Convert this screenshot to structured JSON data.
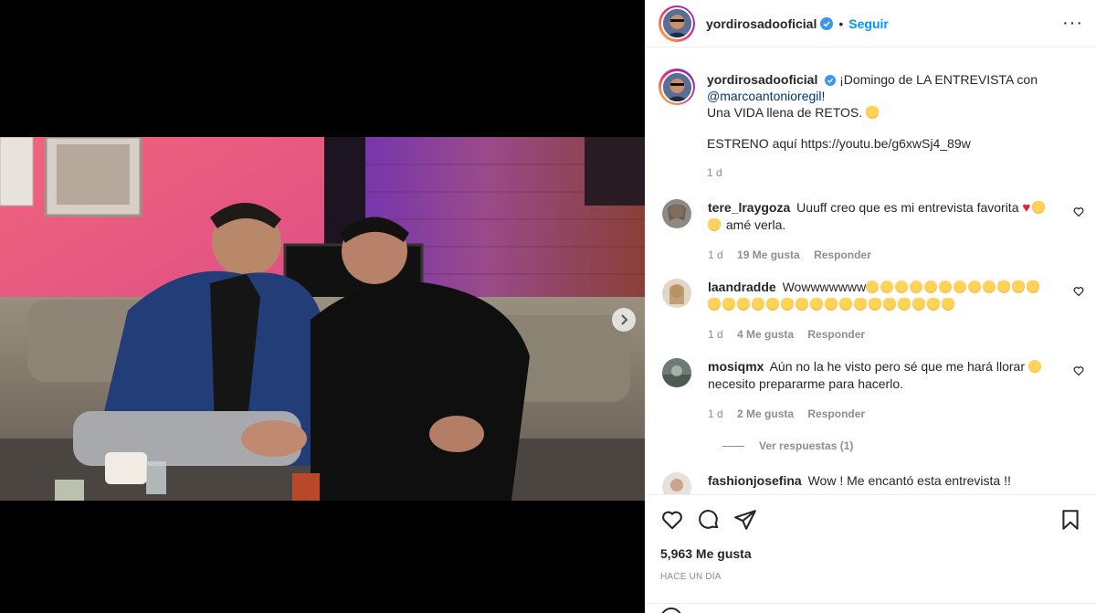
{
  "post": {
    "username": "yordirosadooficial",
    "follow_label": "Seguir",
    "more_label": "···",
    "caption_line1": "¡Domingo de LA ENTREVISTA con",
    "caption_mention": "@marcoantonioregil!",
    "caption_line2": "Una VIDA llena de RETOS.",
    "caption_line3": "ESTRENO aquí https://youtu.be/g6xwSj4_89w",
    "time": "1 d"
  },
  "comments": [
    {
      "username": "tere_lraygoza",
      "text": "Uuuff creo que es mi entrevista favorita",
      "text2": "amé verla.",
      "time": "1 d",
      "likes": "19 Me gusta",
      "reply_label": "Responder"
    },
    {
      "username": "laandradde",
      "text": "Wowwwwwww",
      "time": "1 d",
      "likes": "4 Me gusta",
      "reply_label": "Responder"
    },
    {
      "username": "mosiqmx",
      "text": "Aún no la he visto pero sé que me hará llorar",
      "text2": "necesito prepararme para hacerlo.",
      "time": "1 d",
      "likes": "2 Me gusta",
      "reply_label": "Responder"
    },
    {
      "username": "fashionjosefina",
      "text": "Wow ! Me encantó esta entrevista !!"
    }
  ],
  "view_replies": "Ver respuestas (1)",
  "footer": {
    "likes": "5,963 Me gusta",
    "posted": "HACE UN DÍA"
  },
  "icons": {
    "like": "heart-icon",
    "comment": "comment-icon",
    "share": "paper-plane-icon",
    "save": "bookmark-icon",
    "verified": "verified-badge-icon",
    "next": "chevron-right-icon"
  },
  "colors": {
    "accent": "#0095f6",
    "verified": "#3897f0",
    "mention": "#00376b",
    "muted": "#8e8e8e"
  }
}
